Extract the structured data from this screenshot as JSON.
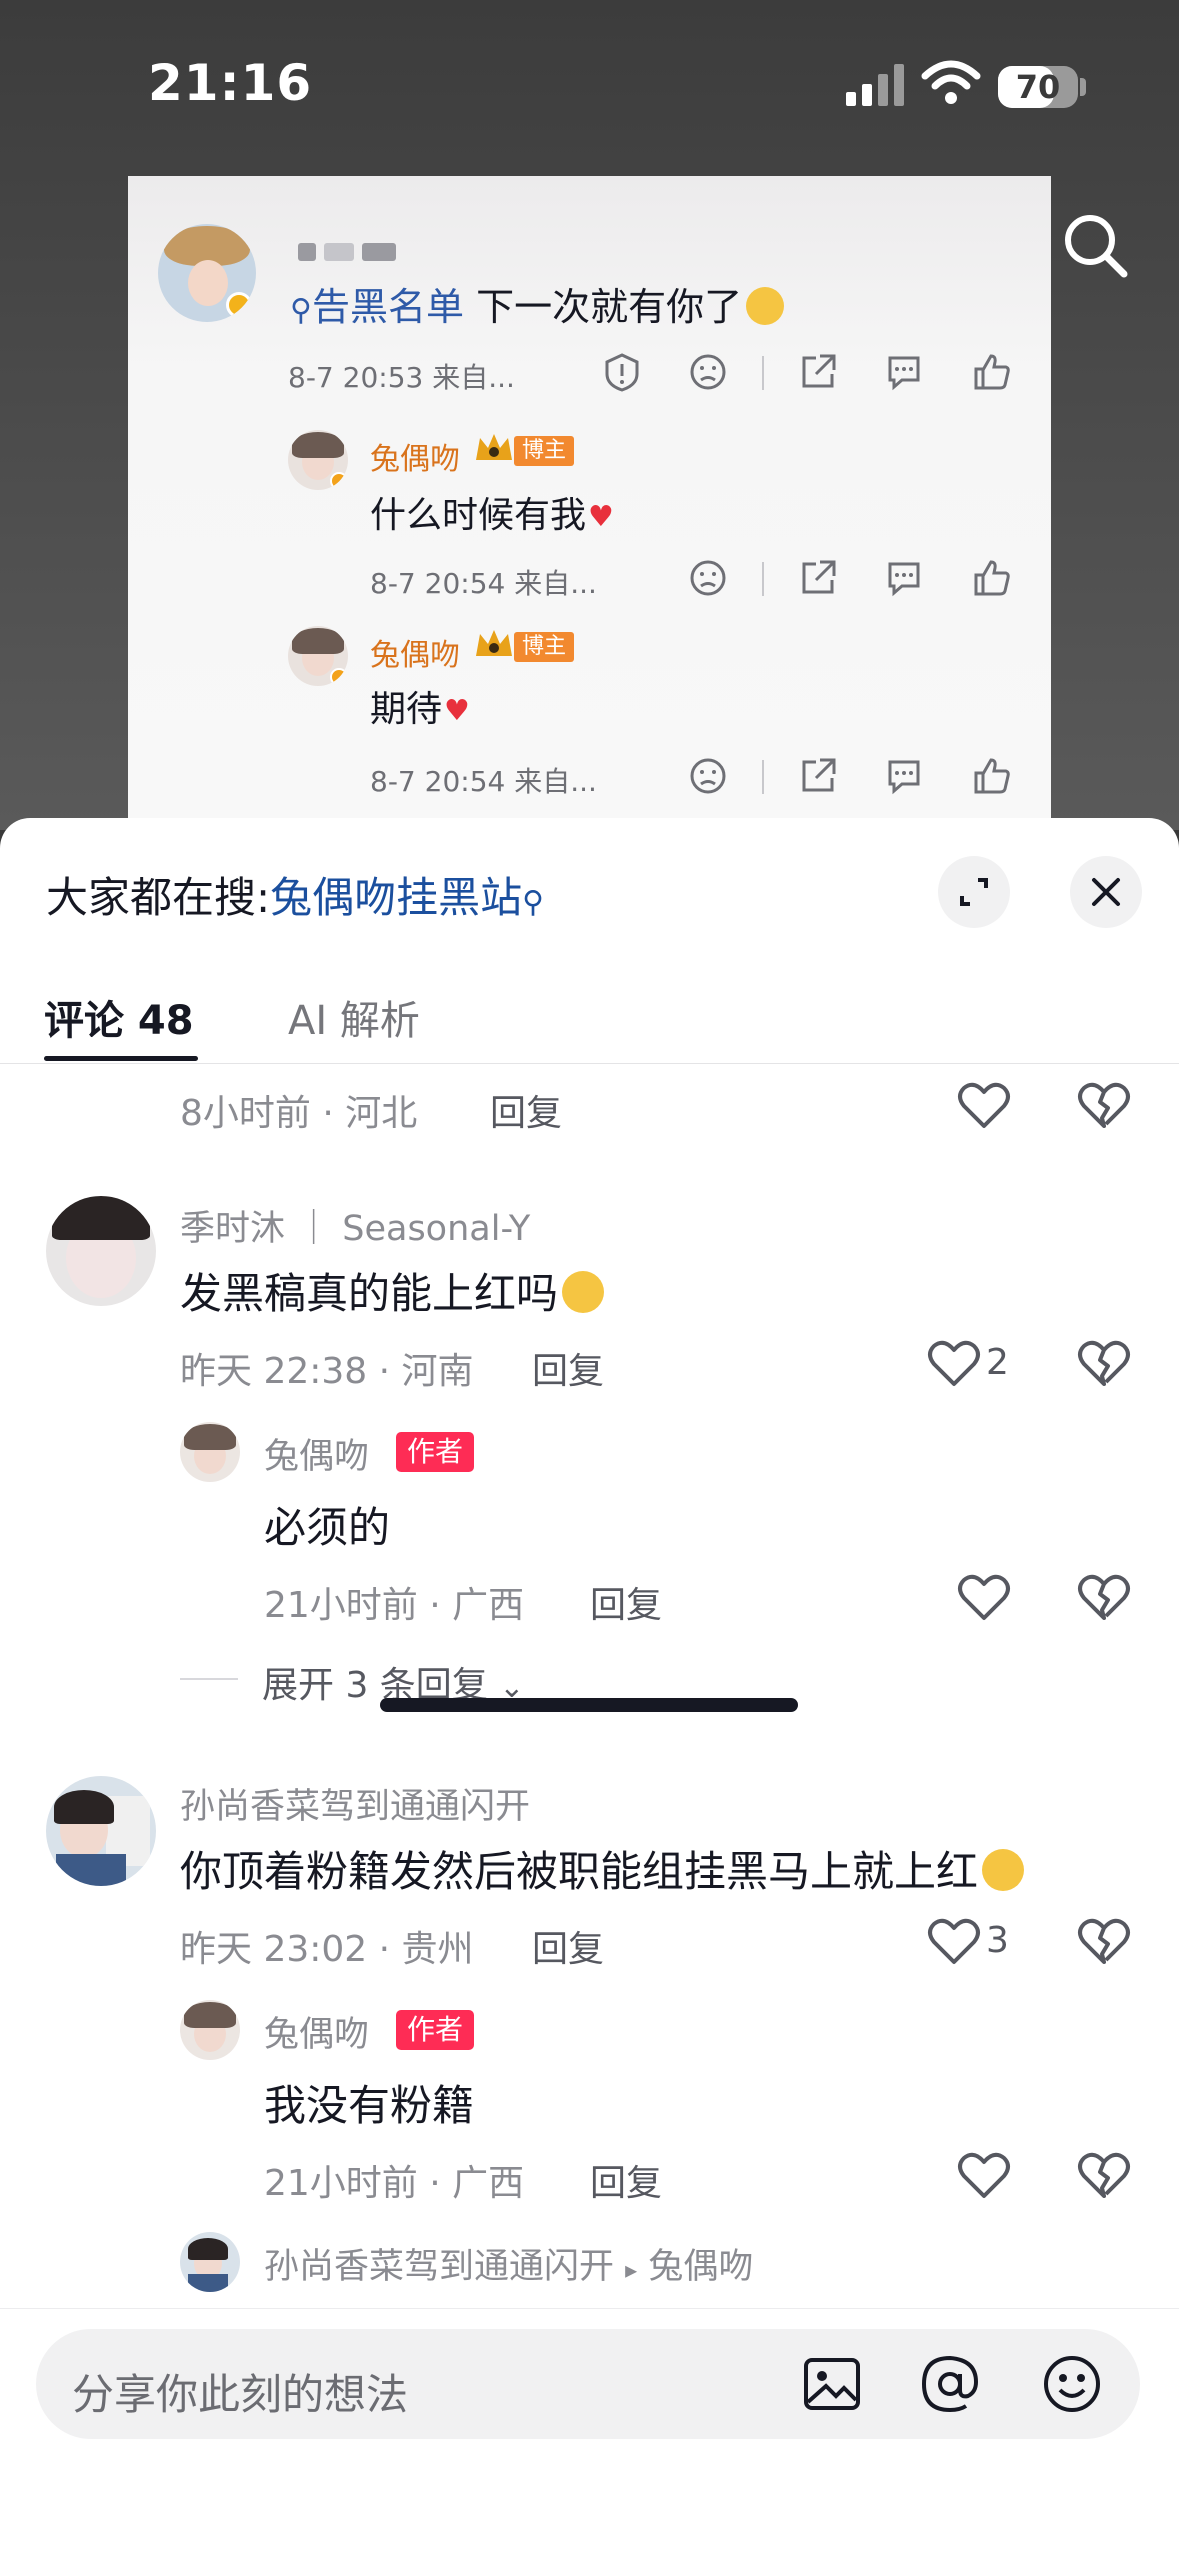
{
  "status_bar": {
    "time": "21:16",
    "battery": "70"
  },
  "post_card": {
    "main_comment": {
      "search_link": "告黑名单",
      "text": "下一次就有你了",
      "time_source": "8-7 20:53 来自..."
    },
    "replies": [
      {
        "name": "兔偶吻",
        "badge": "博主",
        "text": "什么时候有我",
        "time_source": "8-7 20:54 来自..."
      },
      {
        "name": "兔偶吻",
        "badge": "博主",
        "text": "期待",
        "time_source": "8-7 20:54 来自..."
      }
    ]
  },
  "sheet": {
    "hot_search_label": "大家都在搜:",
    "hot_search_keyword": "兔偶吻挂黑站",
    "tabs": [
      {
        "label": "评论 48"
      },
      {
        "label": "AI 解析"
      }
    ],
    "partial_meta": "8小时前 · 河北",
    "reply_label": "回复",
    "comments": [
      {
        "user": "季时沐 ｜ Seasonal-Y",
        "text": "发黑稿真的能上红吗",
        "meta": "昨天 22:38 · 河南",
        "likes": "2",
        "author_reply": {
          "user": "兔偶吻",
          "tag": "作者",
          "text": "必须的",
          "meta": "21小时前 · 广西"
        },
        "expand": "展开 3 条回复"
      },
      {
        "user": "孙尚香菜驾到通通闪开",
        "text": "你顶着粉籍发然后被职能组挂黑马上就上红",
        "meta": "昨天 23:02 · 贵州",
        "likes": "3",
        "author_reply": {
          "user": "兔偶吻",
          "tag": "作者",
          "text": "我没有粉籍",
          "meta": "21小时前 · 广西"
        },
        "next_reply": {
          "from": "孙尚香菜驾到通通闪开",
          "to": "兔偶吻"
        }
      }
    ]
  },
  "composer": {
    "placeholder": "分享你此刻的想法"
  },
  "colors": {
    "accent": "#fe2c55",
    "link": "#1b4f9e",
    "blogger_name": "#d9731c"
  }
}
